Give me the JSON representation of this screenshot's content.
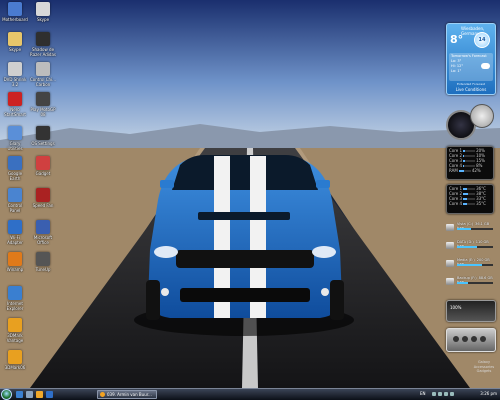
{
  "desktop": {
    "icons": [
      {
        "label": "Motherboard",
        "color": "#4a7bd0",
        "icon": "computer-icon"
      },
      {
        "label": "Skype",
        "color": "#d8d8d8",
        "icon": "folder-icon"
      },
      {
        "label": "Skype",
        "color": "#e8c66a",
        "icon": "folder-icon"
      },
      {
        "label": "Shadow de Razer Adidas",
        "color": "#2f2f2f",
        "icon": "game-icon"
      },
      {
        "label": "DVD Shrink 3.2",
        "color": "#cfcfcf",
        "icon": "disc-icon"
      },
      {
        "label": "Control Chi... Carbon",
        "color": "#bdbdbd",
        "icon": "gear-icon"
      },
      {
        "label": "Nero StartSmart",
        "color": "#cc2222",
        "icon": "nero-icon"
      },
      {
        "label": "Play MotoGP 08",
        "color": "#444444",
        "icon": "game-icon"
      },
      {
        "label": "Glary Utilities",
        "color": "#5a8fd8",
        "icon": "tool-icon"
      },
      {
        "label": "OS Settings",
        "color": "#333333",
        "icon": "settings-icon"
      },
      {
        "label": "Google Earth",
        "color": "#3a70c0",
        "icon": "globe-icon"
      },
      {
        "label": "Gadget",
        "color": "#d04040",
        "icon": "app-icon"
      },
      {
        "label": "Control Panel",
        "color": "#4a84d0",
        "icon": "control-panel-icon"
      },
      {
        "label": "Speed Fan",
        "color": "#aa2222",
        "icon": "fan-icon"
      },
      {
        "label": "Wi-Fi Adapter",
        "color": "#2f6fc8",
        "icon": "network-icon"
      },
      {
        "label": "Microsoft Office",
        "color": "#3a5fb0",
        "icon": "office-icon"
      },
      {
        "label": "Winamp",
        "color": "#e07a1a",
        "icon": "winamp-icon"
      },
      {
        "label": "TuneUp",
        "color": "#555555",
        "icon": "tool-icon"
      },
      {
        "label": "Internet Explorer",
        "color": "#3a7fd0",
        "icon": "internet-explorer-icon"
      },
      {
        "label": "3DMark Vantage",
        "color": "#e8a020",
        "icon": "benchmark-icon"
      },
      {
        "label": "3DMark06",
        "color": "#e8a020",
        "icon": "benchmark-icon"
      }
    ]
  },
  "gadgets": {
    "weather": {
      "city": "Wiesbaden, Germany",
      "temp": "8°",
      "icon_text": "14",
      "forecast_title": "Tomorrow's Forecast",
      "rows": [
        "Lo: 3°",
        "Hi: 12°",
        "Lo: 1°"
      ],
      "source": "Extended Forecast",
      "link": "Live Conditions"
    },
    "cpu": {
      "rows": [
        {
          "label": "Core 1",
          "pct": "20%",
          "value": 20
        },
        {
          "label": "Core 2",
          "pct": "10%",
          "value": 10
        },
        {
          "label": "Core 3",
          "pct": "15%",
          "value": 15
        },
        {
          "label": "Core 4",
          "pct": "8%",
          "value": 8
        },
        {
          "label": "RAM",
          "pct": "42%",
          "value": 42
        }
      ]
    },
    "temps": {
      "rows": [
        {
          "label": "Core 1",
          "pct": "36°C",
          "value": 36
        },
        {
          "label": "Core 2",
          "pct": "38°C",
          "value": 38
        },
        {
          "label": "Core 3",
          "pct": "33°C",
          "value": 33
        },
        {
          "label": "Core 4",
          "pct": "35°C",
          "value": 35
        }
      ]
    },
    "drives": [
      {
        "label": "Vista (C:)",
        "detail": "36.1 GB free",
        "fill": 0.4
      },
      {
        "label": "DATA (D:)",
        "detail": "110 GB free",
        "fill": 0.55
      },
      {
        "label": "Media (E:)",
        "detail": "200 GB free",
        "fill": 0.7
      },
      {
        "label": "Backup (F:)",
        "detail": "88.6 GB free",
        "fill": 0.3
      }
    ],
    "network": {
      "percent": "100%"
    },
    "brand": [
      "Galaxy",
      "Accessories",
      "Gadgets"
    ]
  },
  "taskbar": {
    "task_label": "039. Armin van Buur...",
    "tray_lang": "EN",
    "clock": "3:26 pm",
    "colors": {
      "accent": "#f3a221",
      "orb": "#1a6f2a"
    }
  }
}
